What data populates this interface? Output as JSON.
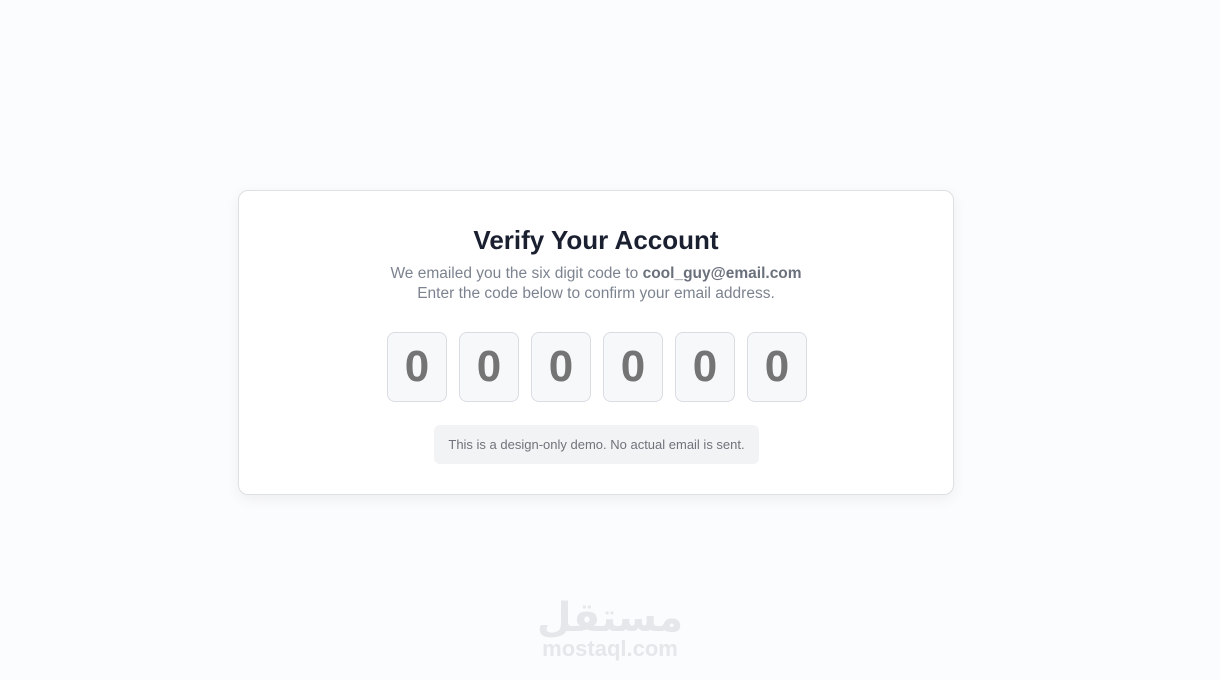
{
  "card": {
    "title": "Verify Your Account",
    "line1_prefix": "We emailed you the six digit code to ",
    "email": "cool_guy@email.com",
    "line2": "Enter the code below to confirm your email address.",
    "code_digits": [
      "0",
      "0",
      "0",
      "0",
      "0",
      "0"
    ],
    "note": "This is a design-only demo. No actual email is sent."
  },
  "watermark": {
    "arabic": "مستقل",
    "latin": "mostaql.com"
  },
  "colors": {
    "background": "#fbfcfd",
    "title": "#1a2030",
    "muted_text": "#7c8390",
    "digit_text": "#747474"
  }
}
